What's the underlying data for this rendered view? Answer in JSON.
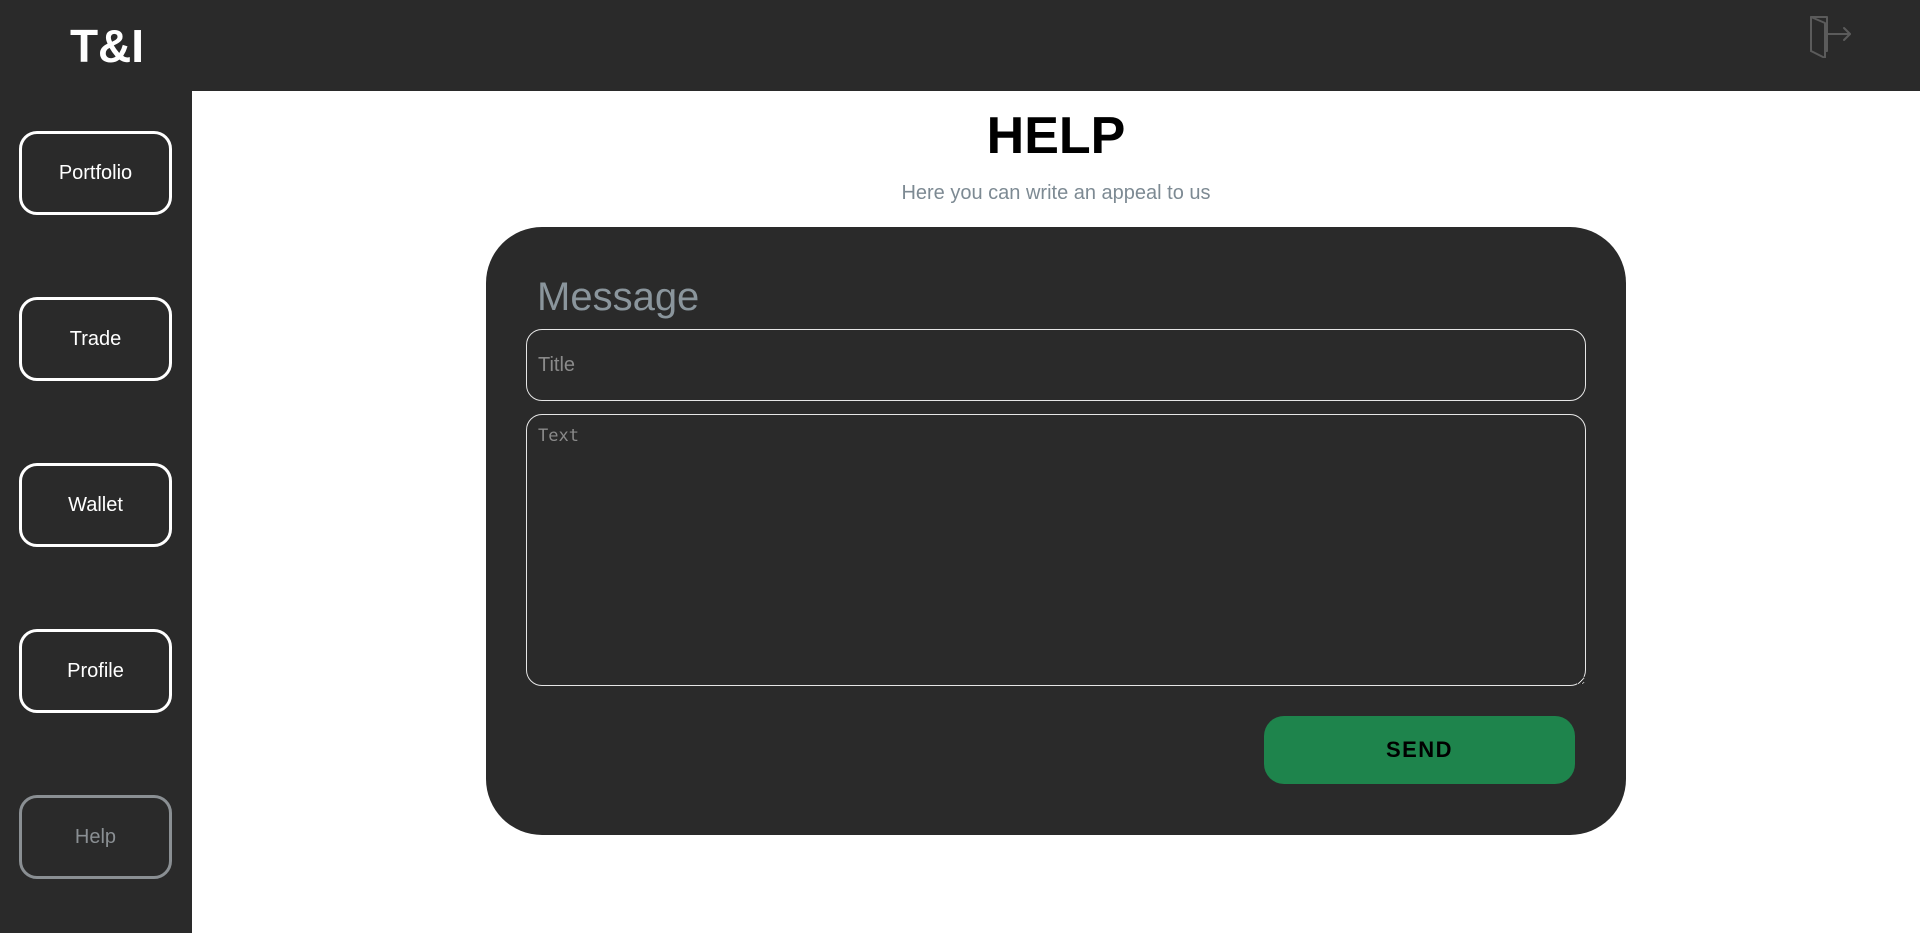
{
  "header": {
    "logo": "T&I",
    "logout_icon": "logout-door-icon"
  },
  "sidebar": {
    "items": [
      {
        "label": "Portfolio"
      },
      {
        "label": "Trade"
      },
      {
        "label": "Wallet"
      },
      {
        "label": "Profile"
      },
      {
        "label": "Help",
        "active": true
      }
    ]
  },
  "main": {
    "title": "HELP",
    "subtitle": "Here you can write an appeal to us",
    "form": {
      "heading": "Message",
      "title_placeholder": "Title",
      "title_value": "",
      "text_placeholder": "Text",
      "text_value": "",
      "send_label": "SEND"
    }
  },
  "colors": {
    "dark": "#2a2a2a",
    "send_green": "#1e844c",
    "muted": "#8a8f93"
  }
}
